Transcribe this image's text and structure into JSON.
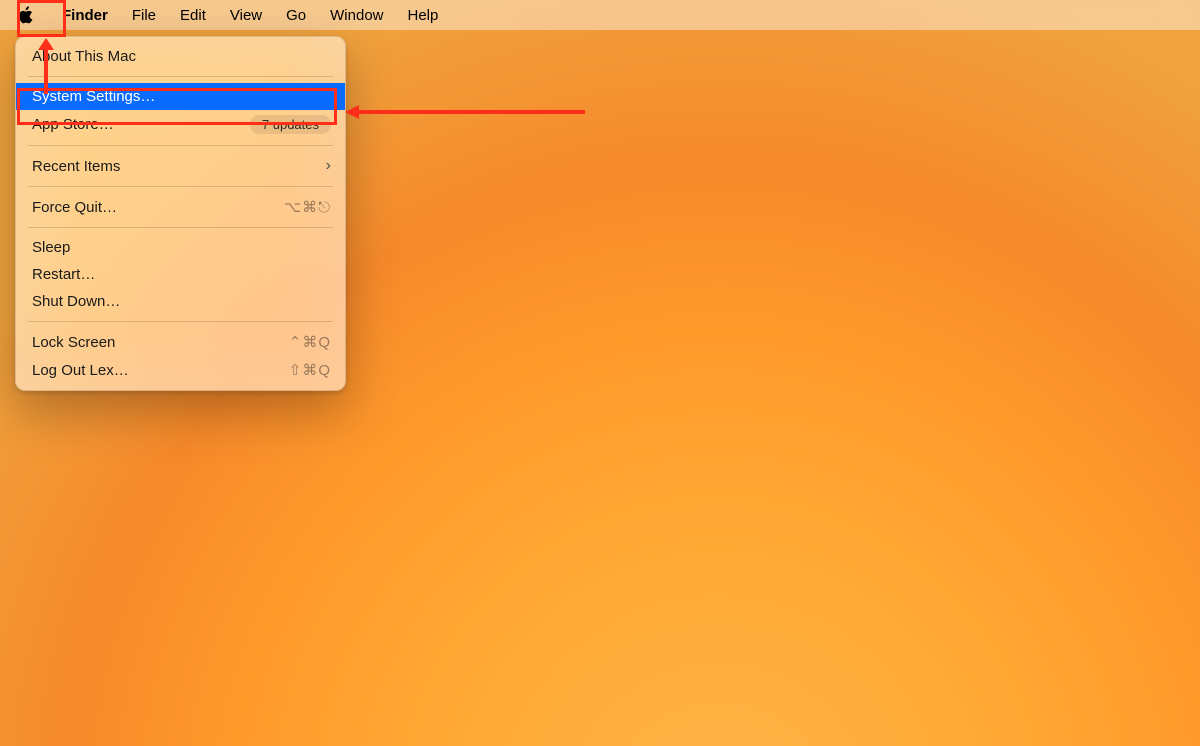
{
  "menubar": {
    "items": [
      {
        "label": "Finder",
        "is_app": true
      },
      {
        "label": "File"
      },
      {
        "label": "Edit"
      },
      {
        "label": "View"
      },
      {
        "label": "Go"
      },
      {
        "label": "Window"
      },
      {
        "label": "Help"
      }
    ]
  },
  "apple_menu": {
    "about": "About This Mac",
    "system_settings": "System Settings…",
    "app_store": "App Store…",
    "app_store_badge": "7 updates",
    "recent_items": "Recent Items",
    "force_quit": "Force Quit…",
    "force_quit_shortcut": "⌥⌘⎋",
    "sleep": "Sleep",
    "restart": "Restart…",
    "shutdown": "Shut Down…",
    "lock_screen": "Lock Screen",
    "lock_screen_shortcut": "⌃⌘Q",
    "log_out": "Log Out Lex…",
    "log_out_shortcut": "⇧⌘Q"
  },
  "annotations": {
    "highlight_apple": true,
    "highlight_system_settings": true
  },
  "colors": {
    "selection": "#0a6bff",
    "annotation": "#ff2e18"
  }
}
